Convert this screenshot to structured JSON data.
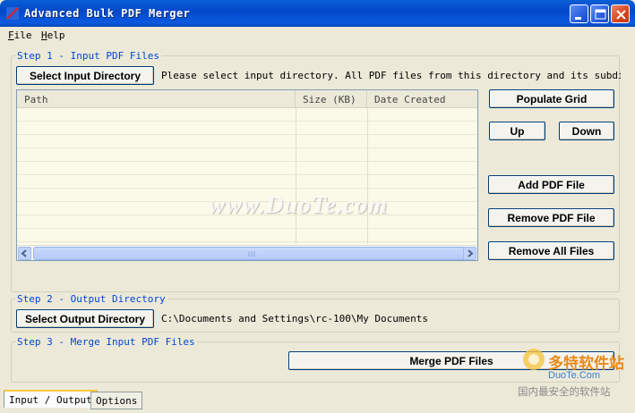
{
  "window": {
    "title": "Advanced Bulk PDF Merger"
  },
  "menu": {
    "file": "File",
    "help": "Help"
  },
  "step1": {
    "legend": "Step 1 - Input PDF Files",
    "select_button": "Select Input Directory",
    "hint": "Please select input directory. All PDF files from this directory and its subdirectories",
    "columns": [
      "Path",
      "Size (KB)",
      "Date Created"
    ],
    "rows": [],
    "buttons": {
      "populate": "Populate Grid",
      "up": "Up",
      "down": "Down",
      "add": "Add PDF File",
      "remove": "Remove PDF File",
      "remove_all": "Remove All Files"
    }
  },
  "step2": {
    "legend": "Step 2 - Output Directory",
    "select_button": "Select Output Directory",
    "path": "C:\\Documents and Settings\\rc-100\\My Documents"
  },
  "step3": {
    "legend": "Step 3 - Merge Input PDF Files",
    "merge_button": "Merge PDF Files"
  },
  "tabs": [
    "Input / Output",
    "Options"
  ],
  "watermark": "www.DuoTe.com",
  "brand": {
    "cn": "多特软件站",
    "en": "DuoTe.Com",
    "tagline": "国内最安全的软件站"
  },
  "icons": {
    "app": "pdf-app-icon",
    "minimize": "minimize-icon",
    "maximize": "maximize-icon",
    "close": "close-icon",
    "scroll_left": "arrow-left-icon",
    "scroll_right": "arrow-right-icon"
  },
  "colors": {
    "titlebar": "#0a5fd6",
    "legend": "#0046d5",
    "close": "#d9431a",
    "grid_bg": "#fbfae8"
  }
}
